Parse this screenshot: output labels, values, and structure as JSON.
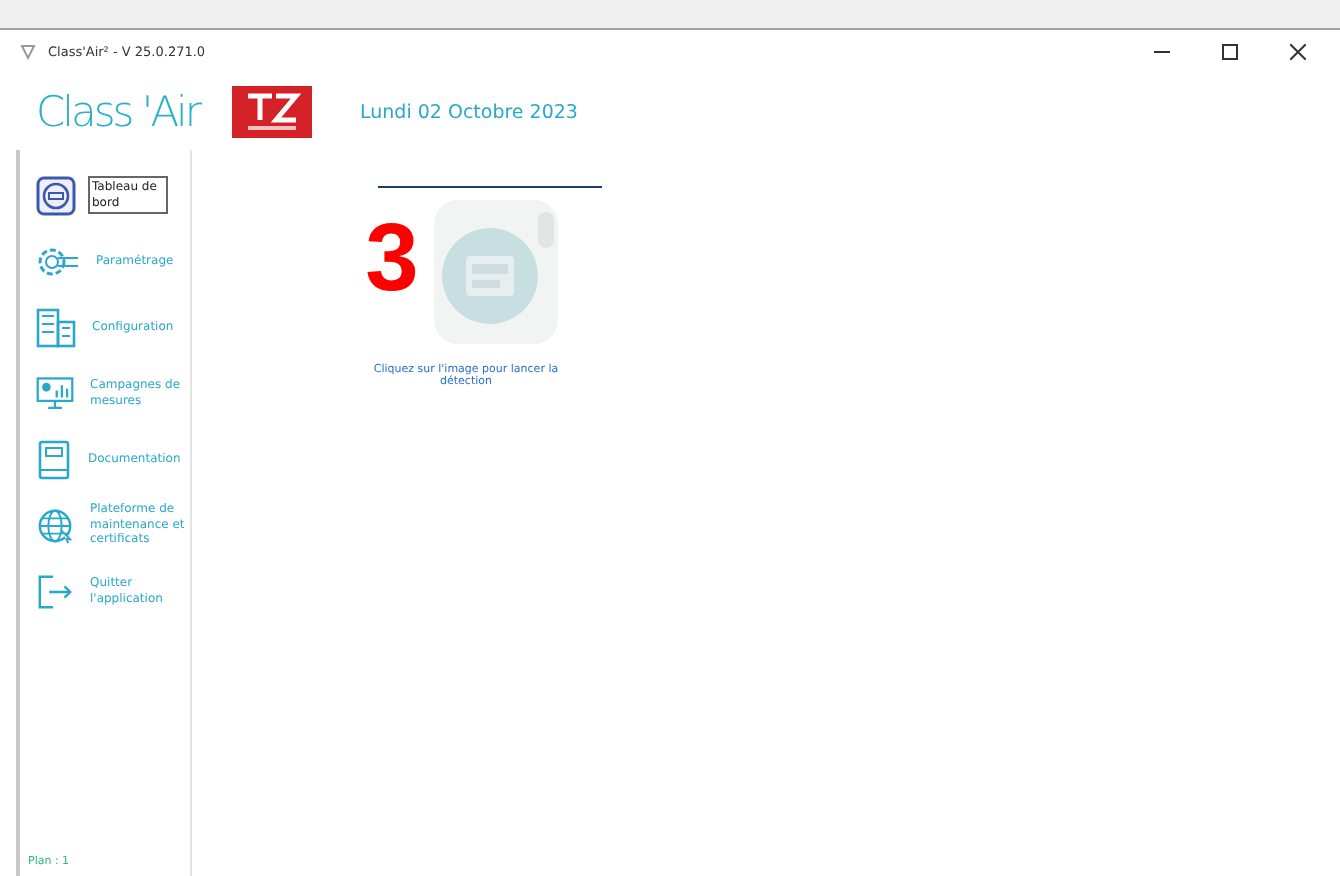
{
  "window": {
    "title": "Class'Air² - V 25.0.271.0"
  },
  "header": {
    "app_name": "Class 'Air",
    "date": "Lundi 02 Octobre 2023"
  },
  "sidebar": {
    "items": [
      {
        "kind": "dashboard",
        "label": "Tableau de bord",
        "selected": true
      },
      {
        "kind": "settings",
        "label": "Paramétrage",
        "selected": false
      },
      {
        "kind": "building",
        "label": "Configuration",
        "selected": false
      },
      {
        "kind": "campaign",
        "label": "Campagnes de mesures",
        "selected": false
      },
      {
        "kind": "book",
        "label": "Documentation",
        "selected": false
      },
      {
        "kind": "globe",
        "label": "Plateforme de maintenance et certificats",
        "selected": false
      },
      {
        "kind": "exit",
        "label": "Quitter l'application",
        "selected": false
      }
    ],
    "footer": "Plan : 1"
  },
  "main": {
    "device_number": "3",
    "caption": "Cliquez sur l'image pour lancer la détection"
  }
}
